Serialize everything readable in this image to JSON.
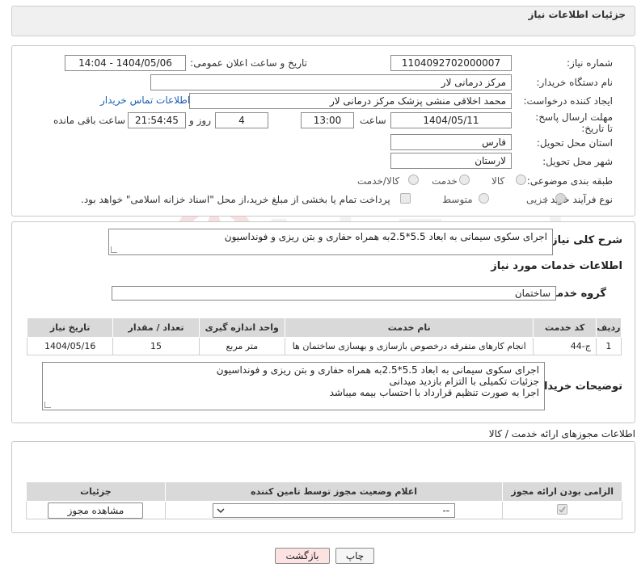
{
  "header": {
    "title": "جزئیات اطلاعات نیاز"
  },
  "form": {
    "need_number_label": "شماره نیاز:",
    "need_number": "1104092702000007",
    "announce_label": "تاریخ و ساعت اعلان عمومی:",
    "announce_value": "1404/05/06 - 14:04",
    "buyer_org_label": "نام دستگاه خریدار:",
    "buyer_org": "مرکز درمانی لار",
    "creator_label": "ایجاد کننده درخواست:",
    "creator": "محمد  اخلاقی منشی پزشک مرکز درمانی لار",
    "contact_link": "اطلاعات تماس خریدار",
    "deadline_label": "مهلت ارسال پاسخ: تا تاریخ:",
    "deadline_date": "1404/05/11",
    "time_label": "ساعت",
    "deadline_time": "13:00",
    "days_value": "4",
    "days_label": "روز و",
    "remaining_time": "21:54:45",
    "remaining_label": "ساعت باقی مانده",
    "province_label": "استان محل تحویل:",
    "province": "فارس",
    "city_label": "شهر محل تحویل:",
    "city": "لارستان",
    "category_label": "طبقه بندی موضوعی:",
    "category_options": [
      "کالا",
      "خدمت",
      "کالا/خدمت"
    ],
    "process_label": "نوع فرآیند خرید :",
    "process_options": [
      "جزیی",
      "متوسط"
    ],
    "payment_note": "پرداخت تمام یا بخشی از مبلغ خرید،از محل \"اسناد خزانه اسلامی\" خواهد بود."
  },
  "summary": {
    "label": "شرح کلی نیاز:",
    "text": "اجرای سکوی سیمانی به ابعاد 5.5*2.5به همراه حفاری و بتن ریزی و فونداسیون",
    "services_title": "اطلاعات خدمات مورد نیاز",
    "group_label": "گروه خدمت:",
    "group_value": "ساختمان"
  },
  "services_table": {
    "headers": [
      "ردیف",
      "کد خدمت",
      "نام خدمت",
      "واحد اندازه گیری",
      "تعداد / مقدار",
      "تاریخ نیاز"
    ],
    "rows": [
      [
        "1",
        "ج-44",
        "انجام کارهای متفرقه درخصوص بازسازی و بهسازی ساختمان ها",
        "متر مربع",
        "15",
        "1404/05/16"
      ]
    ]
  },
  "buyer_notes": {
    "label": "توضیحات خریدار:",
    "lines": [
      "اجرای سکوی سیمانی به ابعاد 5.5*2.5به همراه حفاری و بتن ریزی و فونداسیون",
      "جزئیات تکمیلی با التزام بازدید میدانی",
      "اجرا به صورت تنظیم قرارداد با احتساب بیمه میباشد"
    ]
  },
  "permits": {
    "title": "اطلاعات مجوزهای ارائه خدمت / کالا",
    "headers": [
      "الزامی بودن ارائه مجوز",
      "اعلام وضعیت مجوز توسط تامین کننده",
      "جزئیات"
    ],
    "select_value": "--",
    "view_button": "مشاهده مجوز"
  },
  "footer": {
    "print_button": "چاپ",
    "back_button": "بازگشت"
  },
  "watermark": {
    "text": "AriaTender.neT"
  },
  "colors": {
    "link": "#1a5fb4",
    "back_button_bg": "#fde2e2",
    "header_bg": "#f0f0f0",
    "table_header_bg": "#d9d9d9"
  }
}
